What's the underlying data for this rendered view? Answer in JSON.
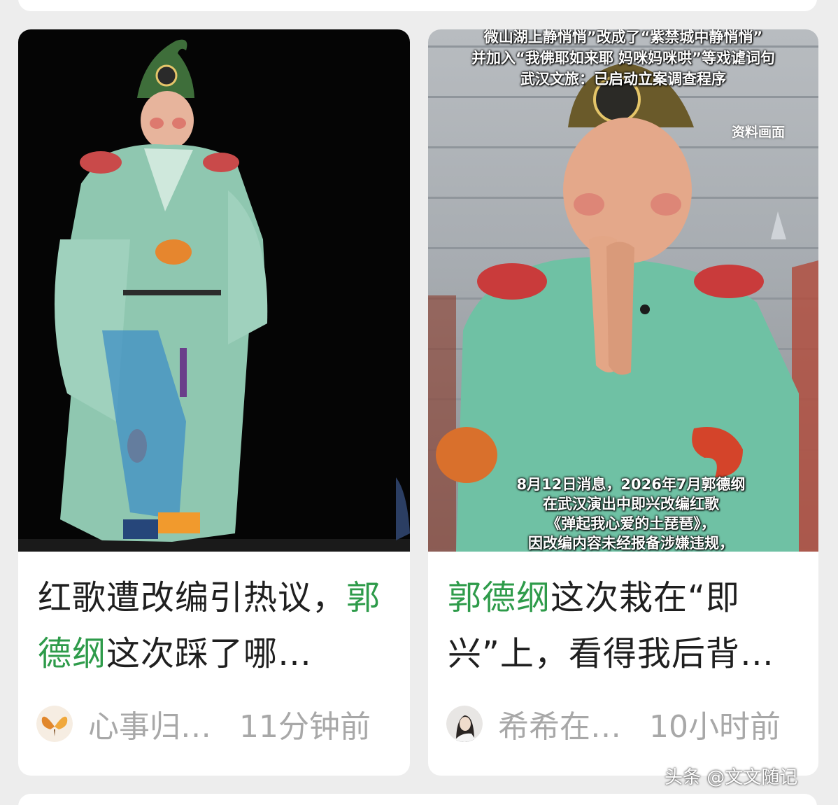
{
  "cards": [
    {
      "title_part1": "红歌遭改编引热议，",
      "title_highlight": "郭德纲",
      "title_part2": "这次踩了哪…",
      "author": "心事归…",
      "time": "11分钟前",
      "image_icon": "stage-performer-image"
    },
    {
      "title_highlight": "郭德纲",
      "title_part1": "这次栽在“即兴”上，看得我后背…",
      "author": "希希在…",
      "time": "10小时前",
      "image_icon": "performer-close-up-image",
      "caption_top": [
        "微山湖上静悄悄”改成了“紫禁城中静悄悄”",
        "并加入“我佛耶如来耶 妈咪妈咪哄”等戏谑词句",
        "武汉文旅：已启动立案调查程序"
      ],
      "caption_tag": "资料画面",
      "caption_bottom": [
        "8月12日消息，2026年7月郭德纲",
        "在武汉演出中即兴改编红歌",
        "《弹起我心爱的土琵琶》，",
        "因改编内容未经报备涉嫌违规，"
      ]
    }
  ],
  "watermark": "头条 @文文随记",
  "colors": {
    "highlight": "#2e9b4a",
    "background": "#ededed",
    "card": "#ffffff",
    "meta_text": "#a8a8a8"
  }
}
